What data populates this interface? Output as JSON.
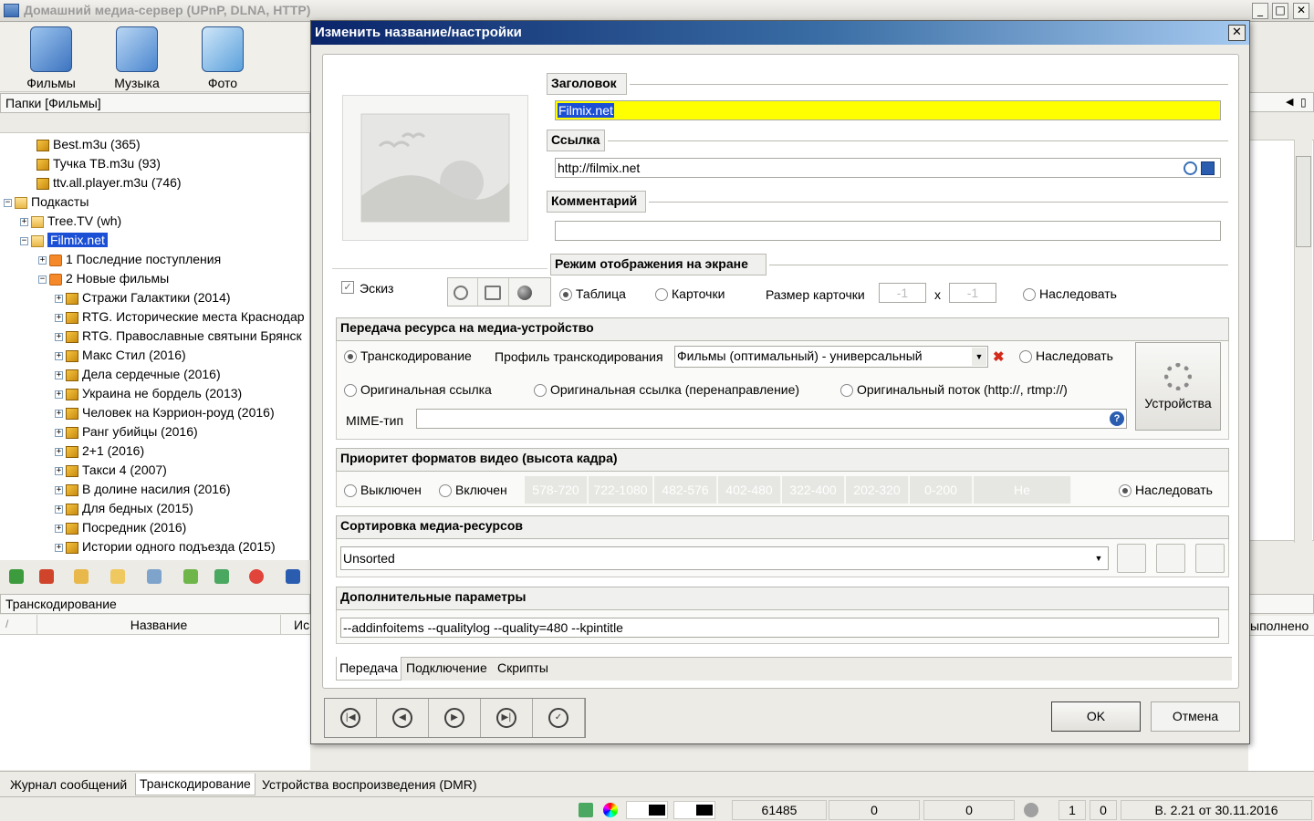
{
  "app": {
    "title": "Домашний медиа-сервер (UPnP, DLNA, HTTP)",
    "window_buttons": [
      "_",
      "□",
      "✕"
    ]
  },
  "toolbar": {
    "items": [
      {
        "label": "Фильмы",
        "icon": "film-icon"
      },
      {
        "label": "Музыка",
        "icon": "music-icon"
      },
      {
        "label": "Фото",
        "icon": "photo-icon"
      }
    ]
  },
  "left_panel": {
    "header": "Папки [Фильмы]",
    "tree": [
      {
        "label": "Best.m3u (365)",
        "icon": "cube",
        "expander": ""
      },
      {
        "label": "Тучка ТВ.m3u (93)",
        "icon": "cube",
        "expander": ""
      },
      {
        "label": "ttv.all.player.m3u (746)",
        "icon": "cube",
        "expander": ""
      },
      {
        "label": "Подкасты",
        "icon": "folder",
        "expander": "−"
      },
      {
        "label": "Tree.TV (wh)",
        "icon": "folder",
        "expander": "+"
      },
      {
        "label": "Filmix.net",
        "icon": "folder",
        "expander": "−",
        "selected": true
      },
      {
        "label": "1 Последние поступления",
        "icon": "rss",
        "expander": "+"
      },
      {
        "label": "2 Новые фильмы",
        "icon": "rss",
        "expander": "−"
      },
      {
        "label": "Стражи Галактики (2014)",
        "icon": "cube",
        "expander": "+"
      },
      {
        "label": "RTG. Исторические места Краснодар",
        "icon": "cube",
        "expander": "+"
      },
      {
        "label": "RTG. Православные святыни Брянск",
        "icon": "cube",
        "expander": "+"
      },
      {
        "label": "Макс Стил (2016)",
        "icon": "cube",
        "expander": "+"
      },
      {
        "label": "Дела сердечные (2016)",
        "icon": "cube",
        "expander": "+"
      },
      {
        "label": "Украина не бордель (2013)",
        "icon": "cube",
        "expander": "+"
      },
      {
        "label": "Человек на Кэррион-роуд (2016)",
        "icon": "cube",
        "expander": "+"
      },
      {
        "label": "Ранг убийцы (2016)",
        "icon": "cube",
        "expander": "+"
      },
      {
        "label": "2+1 (2016)",
        "icon": "cube",
        "expander": "+"
      },
      {
        "label": "Такси 4 (2007)",
        "icon": "cube",
        "expander": "+"
      },
      {
        "label": "В долине насилия (2016)",
        "icon": "cube",
        "expander": "+"
      },
      {
        "label": "Для бедных (2015)",
        "icon": "cube",
        "expander": "+"
      },
      {
        "label": "Посредник (2016)",
        "icon": "cube",
        "expander": "+"
      },
      {
        "label": "Истории одного подъезда (2015)",
        "icon": "cube",
        "expander": "+"
      }
    ]
  },
  "transcoding_panel": {
    "header": "Транскодирование",
    "columns": [
      "Название",
      "Ис"
    ],
    "right_col": "ыполнено"
  },
  "bottom_tabs": [
    "Журнал сообщений",
    "Транскодирование",
    "Устройства воспроизведения (DMR)"
  ],
  "statusbar": {
    "values": [
      "61485",
      "0",
      "0",
      "1",
      "0"
    ],
    "version": "В. 2.21 от 30.11.2016"
  },
  "dialog": {
    "title": "Изменить название/настройки",
    "close": "✕",
    "sections": {
      "title_label": "Заголовок",
      "title_value": "Filmix.net",
      "link_label": "Ссылка",
      "link_value": "http://filmix.net",
      "comment_label": "Комментарий",
      "comment_value": "",
      "display_label": "Режим отображения на экране",
      "thumb_label": "Эскиз",
      "display_options": {
        "table": "Таблица",
        "cards": "Карточки",
        "card_size": "Размер карточки",
        "w": "-1",
        "x": "x",
        "h": "-1",
        "inherit": "Наследовать"
      },
      "transfer_label": "Передача ресурса на медиа-устройство",
      "transcode": "Транскодирование",
      "profile_label": "Профиль транскодирования",
      "profile_value": "Фильмы (оптимальный) - универсальный",
      "inherit": "Наследовать",
      "orig_link": "Оригинальная ссылка",
      "orig_link_redirect": "Оригинальная ссылка (перенаправление)",
      "orig_stream": "Оригинальный поток  (http://, rtmp://)",
      "mime_label": "MIME-тип",
      "mime_value": "",
      "devices_button": "Устройства",
      "priority_label": "Приоритет форматов видео (высота кадра)",
      "off": "Выключен",
      "on": "Включен",
      "formats": [
        "578-720",
        "722-1080",
        "482-576",
        "402-480",
        "322-400",
        "202-320",
        "0-200",
        "Не использовать:"
      ],
      "priority_inherit": "Наследовать",
      "sort_label": "Сортировка медиа-ресурсов",
      "sort_value": "Unsorted",
      "extra_label": "Дополнительные параметры",
      "extra_value": "--addinfoitems --qualitylog --quality=480 --kpintitle"
    },
    "tabs": [
      "Передача",
      "Подключение",
      "Скрипты"
    ],
    "nav_buttons": [
      "|◀",
      "◀",
      "▶",
      "▶|",
      "✓"
    ],
    "ok": "OK",
    "cancel": "Отмена"
  },
  "colors": {
    "selection": "#1a4fd6",
    "highlight_field": "#ffff00",
    "title_gradient_start": "#0a246a"
  }
}
